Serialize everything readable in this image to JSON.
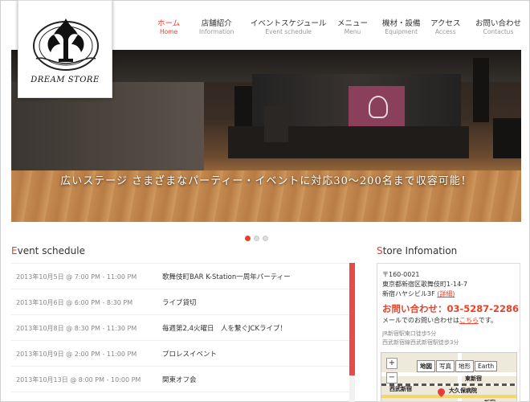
{
  "logo": {
    "text": "DREAM STORE"
  },
  "nav": [
    {
      "jp": "ホーム",
      "en": "Home",
      "active": true
    },
    {
      "jp": "店舗紹介",
      "en": "Information"
    },
    {
      "jp": "イベントスケジュール",
      "en": "Event schedule"
    },
    {
      "jp": "メニュー",
      "en": "Menu"
    },
    {
      "jp": "機材・設備",
      "en": "Equipment"
    },
    {
      "jp": "アクセス",
      "en": "Access"
    },
    {
      "jp": "お問い合わせ",
      "en": "Contactus"
    }
  ],
  "hero": {
    "caption": "広いステージ さまざまなパーティー・イベントに対応30～200名まで収容可能！"
  },
  "slider": {
    "count": 3,
    "active_index": 0
  },
  "events_section": {
    "title_first": "E",
    "title_rest": "vent schedule"
  },
  "events": [
    {
      "date": "2013年10月5日 @ 7:00 PM - 11:00 PM",
      "title": "歌舞伎町BAR K-Station一周年パーティー"
    },
    {
      "date": "2013年10月6日 @ 6:00 PM - 8:30 PM",
      "title": "ライブ貸切"
    },
    {
      "date": "2013年10月8日 @ 8:30 PM - 11:30 PM",
      "title": "毎週第2,4火曜日　人を繋ぐJCKライブ！"
    },
    {
      "date": "2013年10月9日 @ 2:00 PM - 11:00 PM",
      "title": "プロレスイベント"
    },
    {
      "date": "2013年10月13日 @ 8:00 PM - 10:00 PM",
      "title": "関東オフ会"
    }
  ],
  "store_section": {
    "title_first": "S",
    "title_rest": "tore Infomation"
  },
  "store": {
    "postal": "〒160-0021",
    "address1": "東京都新宿区歌舞伎町1-14-7",
    "address2": "新宿ハヤシビル3F",
    "map_link": "(詳細)",
    "phone_label": "お問い合わせ：03-5287-2286",
    "email_prefix": "メールでのお問い合わせは",
    "email_link": "こちら",
    "email_suffix": "です。",
    "access1": "JR新宿駅東口徒歩5分",
    "access2": "西武新宿線西武新宿駅徒歩3分"
  },
  "map": {
    "tabs": [
      "地図",
      "写真",
      "地形",
      "Earth"
    ],
    "labels": {
      "station": "東新宿",
      "seibu": "西武新宿",
      "okubo": "大久保病院",
      "shinjuku": "新宿"
    },
    "zoom_in": "+",
    "zoom_out": "−"
  },
  "colors": {
    "accent": "#e3432a",
    "scroll": "#e84a4a"
  }
}
